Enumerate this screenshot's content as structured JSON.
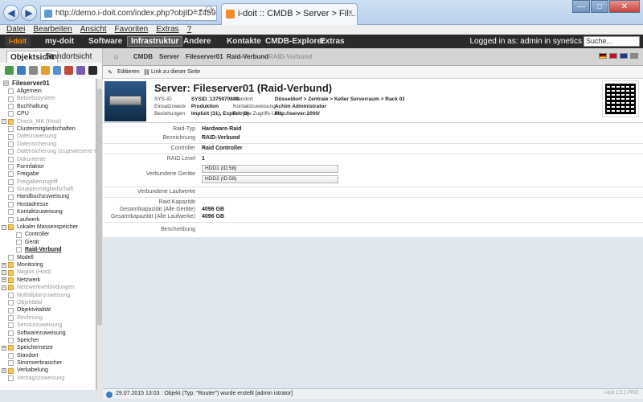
{
  "browser": {
    "address": "http://demo.i-doit.com/index.php?objID=1459&tvMode=10",
    "tab_title": "i-doit :: CMDB > Server > Fil...",
    "close": "×",
    "min": "—",
    "max": "□",
    "close_win": "✕"
  },
  "menubar": [
    "Datei",
    "Bearbeiten",
    "Ansicht",
    "Favoriten",
    "Extras",
    "?"
  ],
  "header": {
    "logo": "i-doit",
    "nav": [
      "my-doit",
      "Software",
      "Infrastruktur",
      "Andere",
      "Kontakte",
      "CMDB-Explorer",
      "Extras"
    ],
    "active_nav": "Infrastruktur",
    "login_text": "Logged in as: admin in synetics",
    "search_value": "Suche..."
  },
  "left": {
    "tabs": [
      "Objektsicht",
      "Standortsicht"
    ],
    "tree_title": "Fileserver01",
    "tree": [
      {
        "label": "Allgemein",
        "type": "item"
      },
      {
        "label": "Betriebssystem",
        "type": "item",
        "grey": true
      },
      {
        "label": "Buchhaltung",
        "type": "item"
      },
      {
        "label": "CPU",
        "type": "item"
      },
      {
        "label": "Check_MK (Host)",
        "type": "folder",
        "grey": true
      },
      {
        "label": "Clustermitgliedschaften",
        "type": "item"
      },
      {
        "label": "Dateizuweisung",
        "type": "item",
        "grey": true
      },
      {
        "label": "Datensicherung",
        "type": "item",
        "grey": true
      },
      {
        "label": "Datensicherung (zugewiesene Obj",
        "type": "item",
        "grey": true
      },
      {
        "label": "Dokumente",
        "type": "item",
        "grey": true
      },
      {
        "label": "Formfaktor",
        "type": "item"
      },
      {
        "label": "Freigabe",
        "type": "item"
      },
      {
        "label": "Freigabenzugriff",
        "type": "item",
        "grey": true
      },
      {
        "label": "Gruppenmitgliedschaft",
        "type": "item",
        "grey": true
      },
      {
        "label": "Handbuchzuweisung",
        "type": "item"
      },
      {
        "label": "Hostadresse",
        "type": "item"
      },
      {
        "label": "Kontaktzuweisung",
        "type": "item"
      },
      {
        "label": "Laufwerk",
        "type": "item"
      },
      {
        "label": "Lokaler Massenspeicher",
        "type": "folder-open"
      },
      {
        "label": "Controller",
        "type": "child"
      },
      {
        "label": "Gerät",
        "type": "child"
      },
      {
        "label": "Raid-Verbund",
        "type": "child-selected"
      },
      {
        "label": "Modell",
        "type": "item"
      },
      {
        "label": "Monitoring",
        "type": "folder"
      },
      {
        "label": "Nagios (Host)",
        "type": "folder",
        "grey": true
      },
      {
        "label": "Netzwerk",
        "type": "folder"
      },
      {
        "label": "Netzwerkverbindungen",
        "type": "folder",
        "grey": true
      },
      {
        "label": "Notfallplanzuweisung",
        "type": "item",
        "grey": true
      },
      {
        "label": "Objektbild",
        "type": "item",
        "grey": true
      },
      {
        "label": "Objektvitalität",
        "type": "item"
      },
      {
        "label": "Rechnung",
        "type": "item",
        "grey": true
      },
      {
        "label": "Servicezuweisung",
        "type": "item",
        "grey": true
      },
      {
        "label": "Softwarezuweisung",
        "type": "item"
      },
      {
        "label": "Speicher",
        "type": "item"
      },
      {
        "label": "Speichernetze",
        "type": "folder"
      },
      {
        "label": "Standort",
        "type": "item"
      },
      {
        "label": "Stromverbraucher",
        "type": "item"
      },
      {
        "label": "Verkabelung",
        "type": "folder"
      },
      {
        "label": "Vertragszuweisung",
        "type": "item",
        "grey": true
      }
    ]
  },
  "breadcrumb": [
    "CMDB",
    "Server",
    "Fileserver01",
    "Raid-Verbund",
    "RAID-Verbund"
  ],
  "toolbar": {
    "edit": "Editieren",
    "link": "Link zu dieser Seite"
  },
  "object": {
    "title": "Server: Fileserver01 (Raid-Verbund)",
    "left_fields": [
      {
        "k": "SYS-ID",
        "v": "SYSID_1375970889"
      },
      {
        "k": "Einsatzzweck",
        "v": "Produktion"
      },
      {
        "k": "Beziehungen",
        "v": "Implizit (31), Explizit (0)"
      }
    ],
    "right_fields": [
      {
        "k": "Standort",
        "v": "Düsseldorf > Zentrale > Keller Serverraum > Rack 01"
      },
      {
        "k": "Kontaktzuweisung",
        "v": "Achim Administrator"
      },
      {
        "k": "Primäre Zugriffs-URL",
        "v": "http://server:2000/"
      }
    ]
  },
  "form": {
    "raid_typ_label": "Raid-Typ",
    "raid_typ": "Hardware-Raid",
    "bezeichnung_label": "Bezeichnung",
    "bezeichnung": "RAID-Verbund",
    "controller_label": "Controller",
    "controller": "Raid Controller",
    "raid_level_label": "RAID Level",
    "raid_level": "1",
    "devices_label": "Verbundene Geräte",
    "devices": [
      "HDD1 (ID:58)",
      "HDD2 (ID:59)"
    ],
    "drives_label": "Verbundene Laufwerke",
    "capacity_label": "Raid Kapazität",
    "total_all_devices_label": "Gesamtkapazität (Alle Geräte)",
    "total_all_devices": "4096 GB",
    "total_all_drives_label": "Gesamtkapazität (Alle Laufwerke)",
    "total_all_drives": "4096 GB",
    "description_label": "Beschreibung"
  },
  "status": {
    "message": "29.07.2015 13:03 : Objekt (Typ: \"Router\") wurde erstellt [admin istrator]",
    "version": "i-doit 1.5.1 PRO"
  }
}
